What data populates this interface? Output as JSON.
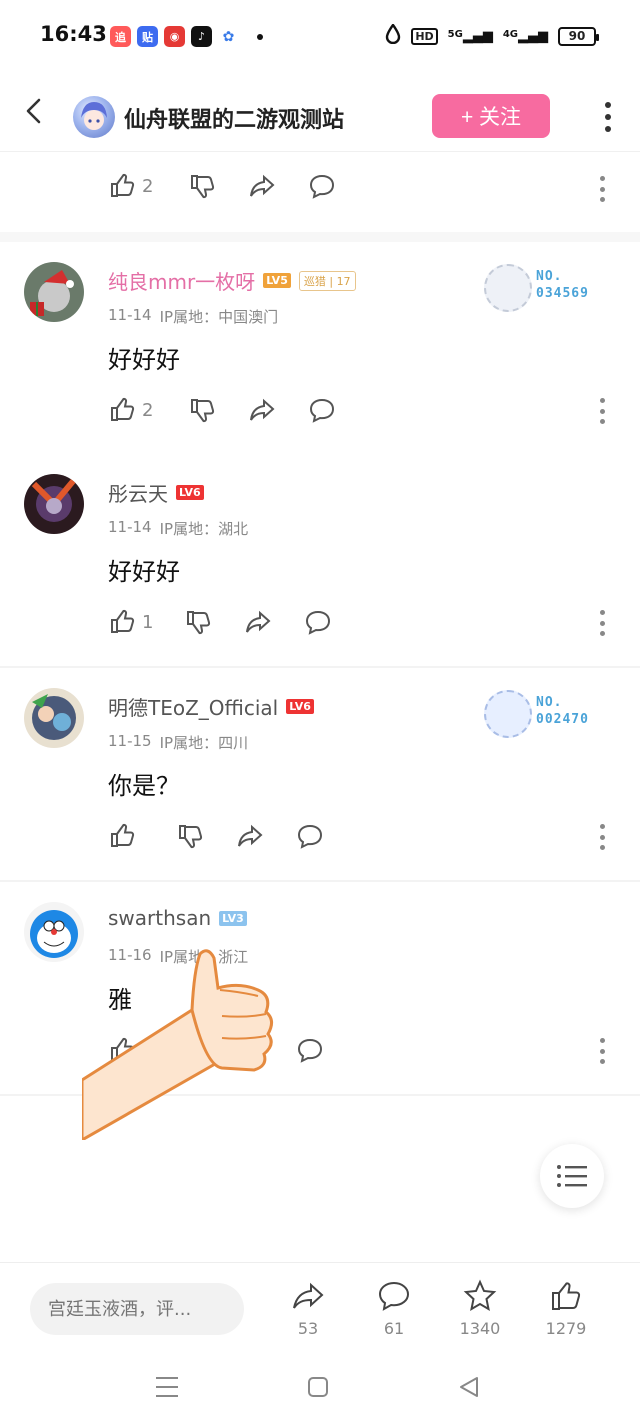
{
  "status_bar": {
    "time": "16:43",
    "app_icons": [
      {
        "icon": "app-icon-red",
        "glyph": "追",
        "color": "#ff5a5a"
      },
      {
        "icon": "app-icon-blue",
        "glyph": "贴",
        "color": "#3d6bf0"
      },
      {
        "icon": "app-icon-netease",
        "glyph": "◉",
        "color": "#e53935"
      },
      {
        "icon": "app-icon-tiktok",
        "glyph": "♪",
        "color": "#111111"
      },
      {
        "icon": "paw-icon",
        "glyph": "🐾",
        "color": "#ffffff"
      }
    ],
    "hd_label": "HD",
    "signal_5g": "5G",
    "signal_4g": "4G",
    "battery": "90"
  },
  "header": {
    "title": "仙舟联盟的二游观测站",
    "follow_label": "+ 关注"
  },
  "partial_top": {
    "like_count": "2"
  },
  "comments": [
    {
      "username": "纯良mmr一枚呀",
      "level": "LV5",
      "tag": "巡猎",
      "tag_num": "17",
      "date": "11-14",
      "ip_label": "IP属地：",
      "ip": "中国澳门",
      "text": "好好好",
      "likes": "2",
      "badge_no": "NO.",
      "badge_num": "034569"
    },
    {
      "username": "彤云天",
      "level": "LV6",
      "date": "11-14",
      "ip_label": "IP属地：",
      "ip": "湖北",
      "text": "好好好",
      "likes": "1"
    },
    {
      "username": "明德TEoZ_Official",
      "level": "LV6",
      "date": "11-15",
      "ip_label": "IP属地：",
      "ip": "四川",
      "text": "你是？",
      "likes": "",
      "badge_no": "NO.",
      "badge_num": "002470"
    },
    {
      "username": "swarthsan",
      "level": "LV3",
      "date": "11-16",
      "ip_label": "IP属地：",
      "ip": "浙江",
      "text": "雅",
      "likes": ""
    }
  ],
  "bottom_bar": {
    "input_placeholder": "宫廷玉液酒，评...",
    "share_count": "53",
    "comment_count": "61",
    "star_count": "1340",
    "like_count": "1279"
  }
}
